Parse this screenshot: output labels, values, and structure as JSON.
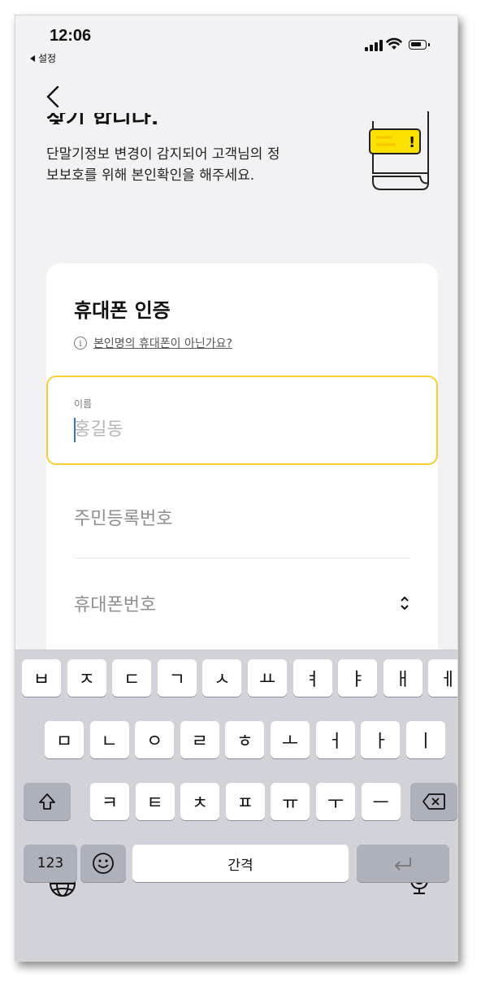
{
  "status_bar": {
    "time": "12:06",
    "back_app": "설정",
    "icons": [
      "signal-icon",
      "wifi-icon",
      "battery-icon"
    ]
  },
  "nav": {
    "back_icon": "chevron-left-icon"
  },
  "intro": {
    "partial_title": "찾기 합니다.",
    "description_line1": "단말기정보 변경이 감지되어 고객님의 정",
    "description_line2": "보보호를 위해 본인확인을 해주세요.",
    "illustration": "document-alert-icon",
    "illustration_badge": "!"
  },
  "card": {
    "title": "휴대폰 인증",
    "not_mine_link": "본인명의 휴대폰이 아닌가요?",
    "name_field": {
      "label": "이름",
      "placeholder": "홍길동",
      "value": ""
    },
    "rrn_field": {
      "placeholder": "주민등록번호",
      "value": ""
    },
    "phone_field": {
      "placeholder": "휴대폰번호",
      "selector_icon": "updown-chevron-icon"
    }
  },
  "keyboard": {
    "row1": [
      "ㅂ",
      "ㅈ",
      "ㄷ",
      "ㄱ",
      "ㅅ",
      "ㅛ",
      "ㅕ",
      "ㅑ",
      "ㅐ",
      "ㅔ"
    ],
    "row2": [
      "ㅁ",
      "ㄴ",
      "ㅇ",
      "ㄹ",
      "ㅎ",
      "ㅗ",
      "ㅓ",
      "ㅏ",
      "ㅣ"
    ],
    "row3": [
      "ㅋ",
      "ㅌ",
      "ㅊ",
      "ㅍ",
      "ㅠ",
      "ㅜ",
      "ㅡ"
    ],
    "numbers_label": "123",
    "space_label": "간격",
    "shift_icon": "shift-icon",
    "delete_icon": "backspace-icon",
    "emoji_icon": "emoji-icon",
    "return_icon": "return-icon",
    "globe_icon": "globe-icon",
    "mic_icon": "microphone-icon"
  },
  "colors": {
    "accent": "#f7cf2e",
    "badge": "#fae100",
    "caret": "#3a6fd8"
  }
}
